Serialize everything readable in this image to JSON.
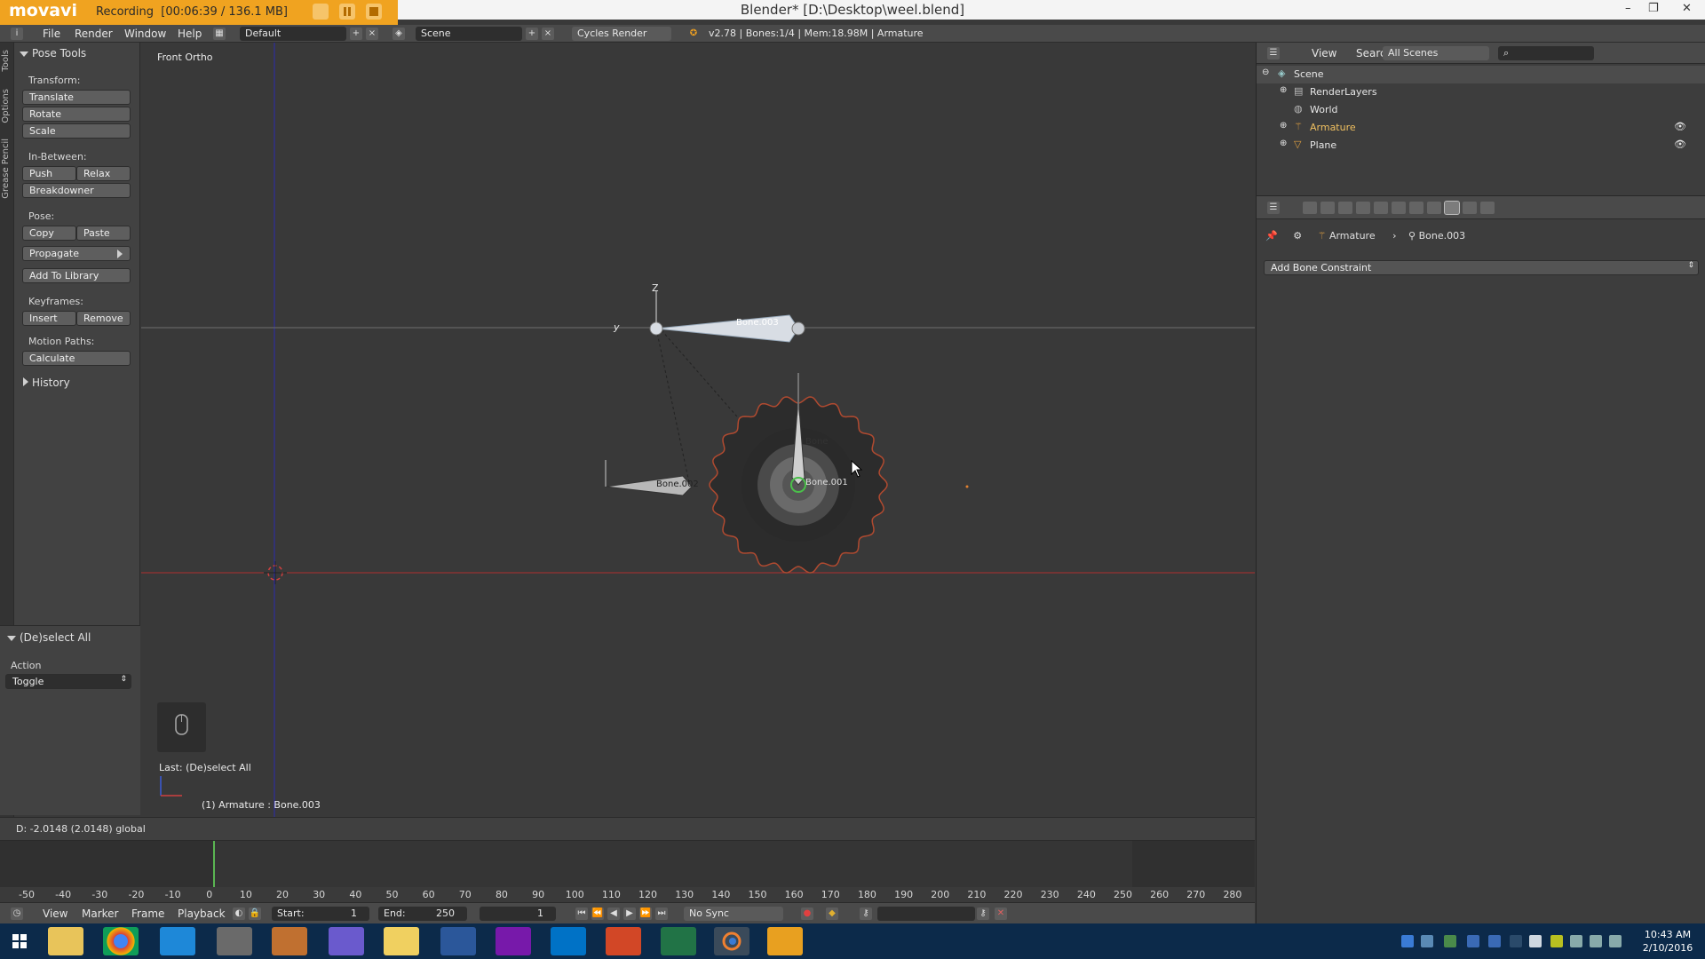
{
  "window": {
    "title": "Blender* [D:\\Desktop\\weel.blend]",
    "controls": {
      "minimize": "–",
      "restore": "❐",
      "close": "✕"
    }
  },
  "recorder": {
    "logo": "movavi",
    "status": "Recording",
    "timer": "[00:06:39 / 136.1 MB]"
  },
  "info_header": {
    "menus": [
      "File",
      "Render",
      "Window",
      "Help"
    ],
    "layout": "Default",
    "scene": "Scene",
    "engine": "Cycles Render",
    "stats": "v2.78 | Bones:1/4 | Mem:18.98M | Armature"
  },
  "tool_tabs": [
    "Tools",
    "Options",
    "Grease Pencil"
  ],
  "tool_shelf": {
    "panel_title": "Pose Tools",
    "transform_label": "Transform:",
    "translate": "Translate",
    "rotate": "Rotate",
    "scale": "Scale",
    "inbetween_label": "In-Between:",
    "push": "Push",
    "relax": "Relax",
    "breakdowner": "Breakdowner",
    "pose_label": "Pose:",
    "copy": "Copy",
    "paste": "Paste",
    "propagate": "Propagate",
    "add_to_library": "Add To Library",
    "keyframes_label": "Keyframes:",
    "insert": "Insert",
    "remove": "Remove",
    "motion_paths_label": "Motion Paths:",
    "calculate": "Calculate",
    "history": "History"
  },
  "operator_panel": {
    "title": "(De)select All",
    "action_label": "Action",
    "action_value": "Toggle"
  },
  "viewport": {
    "view_name": "Front Ortho",
    "last_operator": "Last: (De)select All",
    "active_object": "(1) Armature : Bone.003",
    "bones": [
      "Bone.003",
      "Bone.002",
      "Bone.001",
      "Bone"
    ],
    "axis_labels": {
      "z": "Z",
      "y": "y"
    }
  },
  "status_strip": "D: -2.0148 (2.0148) global",
  "timeline": {
    "ticks": [
      "-50",
      "-40",
      "-30",
      "-20",
      "-10",
      "0",
      "10",
      "20",
      "30",
      "40",
      "50",
      "60",
      "70",
      "80",
      "90",
      "100",
      "110",
      "120",
      "130",
      "140",
      "150",
      "160",
      "170",
      "180",
      "190",
      "200",
      "210",
      "220",
      "230",
      "240",
      "250",
      "260",
      "270",
      "280"
    ],
    "current_frame": 1,
    "menus": [
      "View",
      "Marker",
      "Frame",
      "Playback"
    ],
    "start_label": "Start:",
    "start_value": "1",
    "end_label": "End:",
    "end_value": "250",
    "frame_value": "1",
    "sync": "No Sync"
  },
  "outliner": {
    "view": "View",
    "search": "Search",
    "filter": "All Scenes",
    "items": [
      {
        "name": "Scene"
      },
      {
        "name": "RenderLayers"
      },
      {
        "name": "World"
      },
      {
        "name": "Armature"
      },
      {
        "name": "Plane"
      }
    ]
  },
  "properties": {
    "breadcrumb_object": "Armature",
    "breadcrumb_bone": "Bone.003",
    "add_constraint": "Add Bone Constraint"
  },
  "taskbar": {
    "time": "10:43 AM",
    "date": "2/10/2016"
  },
  "colors": {
    "recorder_bg": "#f0a320",
    "x_axis": "#b03030",
    "y_axis": "#2b2bb0",
    "selected_bone": "#d8dde4",
    "taskbar": "#0c2a4a"
  }
}
